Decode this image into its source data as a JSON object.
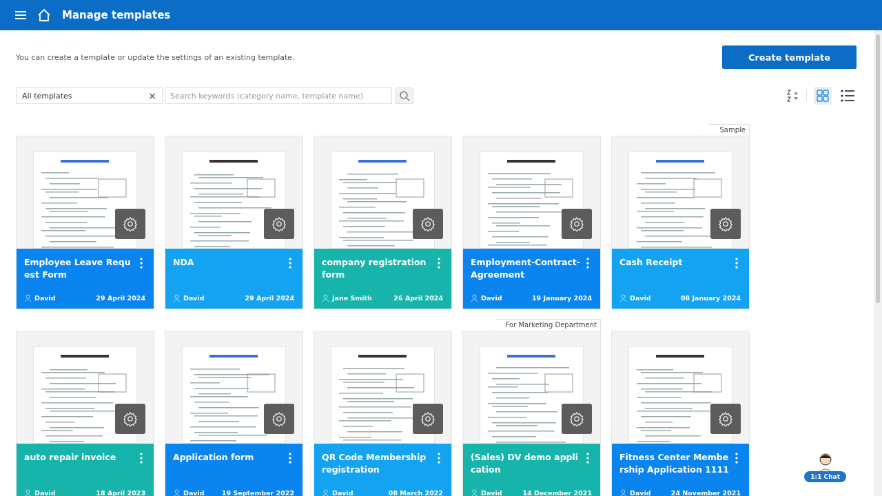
{
  "header": {
    "title": "Manage templates"
  },
  "description": "You can create a template or update the settings of an existing template.",
  "create_button": "Create template",
  "filter": {
    "value": "All templates",
    "clear": "×",
    "search_placeholder": "Search keywords (category name, template name)"
  },
  "view": {
    "grid_selected": true,
    "list_selected": false
  },
  "templates": [
    {
      "title": "Employee Leave Request Form",
      "author": "David",
      "date": "29 April 2024",
      "color": "#0a84ef"
    },
    {
      "title": "NDA",
      "author": "David",
      "date": "29 April 2024",
      "color": "#13a3f1"
    },
    {
      "title": "company registration form",
      "author": "Jane Smith",
      "date": "26 April 2024",
      "color": "#16b4ab"
    },
    {
      "title": "Employment-Contract-Agreement",
      "author": "David",
      "date": "19 January 2024",
      "color": "#0a84ef"
    },
    {
      "title": "Cash Receipt",
      "author": "David",
      "date": "08 January 2024",
      "color": "#13a3f1",
      "tag": "Sample"
    },
    {
      "title": "auto repair invoice",
      "author": "David",
      "date": "18 April 2023",
      "color": "#16b4ab"
    },
    {
      "title": "Application form",
      "author": "David",
      "date": "19 September 2022",
      "color": "#0a84ef"
    },
    {
      "title": "QR Code Membership registration",
      "author": "David",
      "date": "08 March 2022",
      "color": "#13a3f1"
    },
    {
      "title": "(Sales) DV demo application",
      "author": "David",
      "date": "14 December 2021",
      "color": "#16b4ab",
      "tag": "For Marketing Department"
    },
    {
      "title": "Fitness Center Membership Application 1111",
      "author": "David",
      "date": "24 November 2021",
      "color": "#0a84ef"
    }
  ],
  "chat": {
    "label": "1:1 Chat"
  }
}
